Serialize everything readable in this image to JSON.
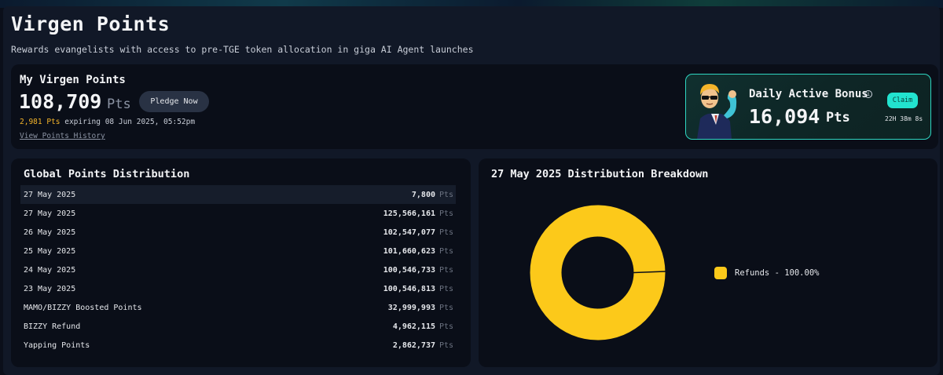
{
  "page": {
    "title": "Virgen Points",
    "subtitle": "Rewards evangelists with access to pre-TGE token allocation in giga AI Agent launches"
  },
  "my_points": {
    "title": "My Virgen Points",
    "value": "108,709",
    "unit": "Pts",
    "pledge_label": "Pledge Now",
    "expiring_amount": "2,981 Pts",
    "expiring_text": "expiring 08 Jun 2025, 05:52pm",
    "history_link": "View Points History"
  },
  "daily_bonus": {
    "title": "Daily Active Bonus",
    "info_icon": "info-icon",
    "value": "16,094",
    "unit": "Pts",
    "claim_label": "Claim",
    "timer": "22H 38m 8s"
  },
  "distribution": {
    "title": "Global Points Distribution",
    "unit": "Pts",
    "rows": [
      {
        "label": "27 May 2025",
        "value": "7,800"
      },
      {
        "label": "27 May 2025",
        "value": "125,566,161"
      },
      {
        "label": "26 May 2025",
        "value": "102,547,077"
      },
      {
        "label": "25 May 2025",
        "value": "101,660,623"
      },
      {
        "label": "24 May 2025",
        "value": "100,546,733"
      },
      {
        "label": "23 May 2025",
        "value": "100,546,813"
      },
      {
        "label": "MAMO/BIZZY Boosted Points",
        "value": "32,999,993"
      },
      {
        "label": "BIZZY Refund",
        "value": "4,962,115"
      },
      {
        "label": "Yapping Points",
        "value": "2,862,737"
      }
    ]
  },
  "breakdown": {
    "title": "27 May 2025 Distribution Breakdown",
    "chart_data": {
      "type": "pie",
      "categories": [
        "Refunds"
      ],
      "values": [
        100.0
      ],
      "legend": [
        "Refunds - 100.00%"
      ],
      "colors": [
        "#fcc91a"
      ]
    }
  },
  "colors": {
    "accent_teal": "#22e3cf",
    "expiring_orange": "#f5b52a",
    "donut_yellow": "#fcc91a"
  }
}
